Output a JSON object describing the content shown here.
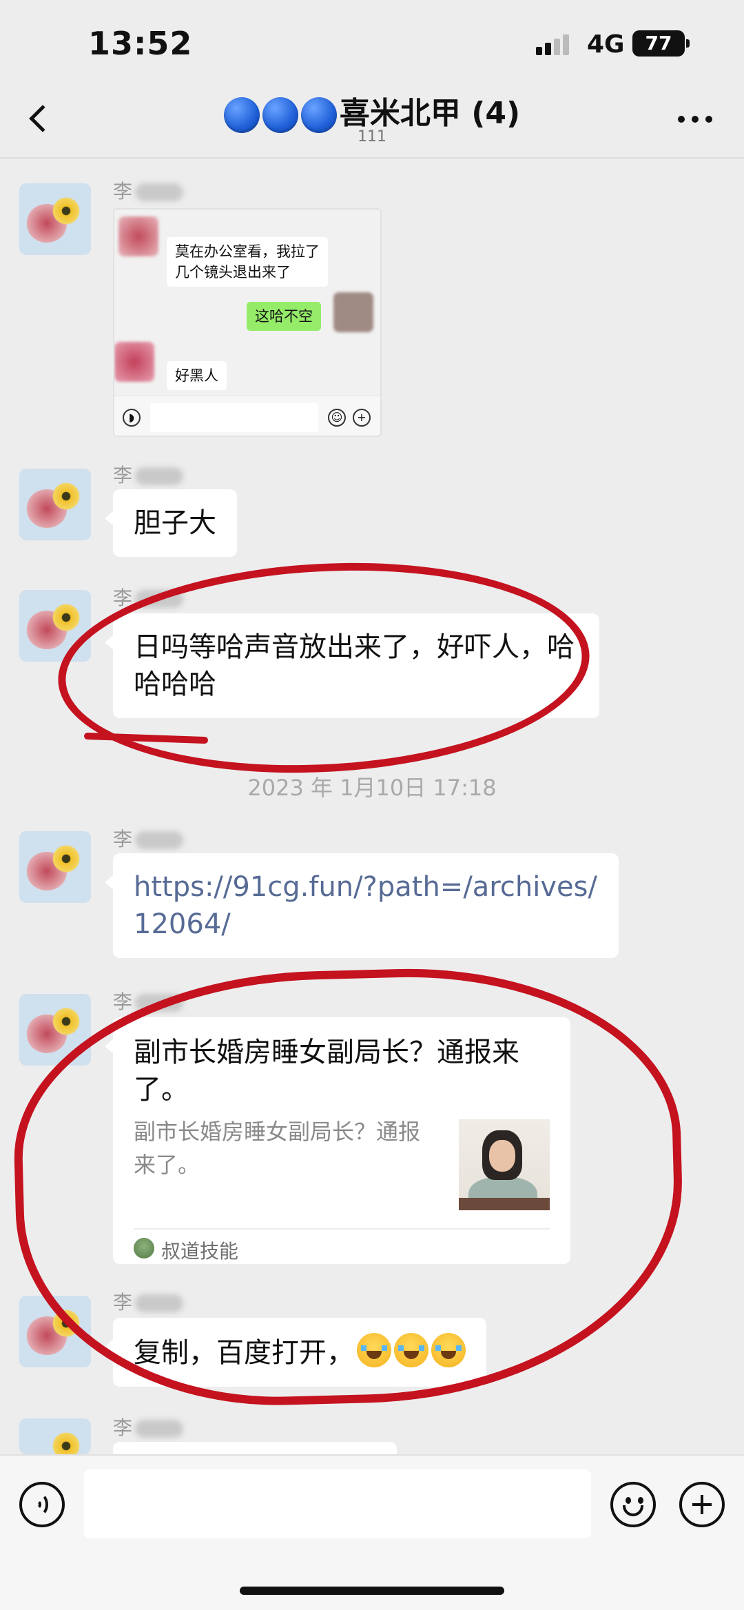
{
  "status_bar": {
    "time": "13:52",
    "network": "4G",
    "battery": "77"
  },
  "nav": {
    "title": "喜米北甲 (4)",
    "subtitle": "111",
    "title_icon": "blue-circle-emoji"
  },
  "messages": [
    {
      "sender": "李",
      "type": "image",
      "image_content": {
        "lines": [
          {
            "side": "left",
            "text": "莫在办公室看，我拉了\n几个镜头退出来了"
          },
          {
            "side": "right",
            "text": "这哈不空"
          },
          {
            "side": "left",
            "text": "好黑人"
          }
        ]
      }
    },
    {
      "sender": "李",
      "type": "text",
      "text": "胆子大"
    },
    {
      "sender": "李",
      "type": "text",
      "text": "日吗等哈声音放出来了，好吓人，哈哈哈哈"
    },
    {
      "sender": "李",
      "type": "link",
      "text": "https://91cg.fun/?path=/archives/12064/"
    },
    {
      "sender": "李",
      "type": "article",
      "title": "副市长婚房睡女副局长？通报来了。",
      "description": "副市长婚房睡女副局长？通报来了。",
      "source": "叔道技能"
    },
    {
      "sender": "李",
      "type": "text",
      "text": "复制，百度打开，",
      "emoji": [
        "face-with-tears-of-joy",
        "face-with-tears-of-joy",
        "face-with-tears-of-joy"
      ]
    }
  ],
  "timestamp": "2023 年 1月10日 17:18",
  "colors": {
    "annotation": "#c4121f",
    "link": "#576b95",
    "background": "#ededed",
    "sent_bubble": "#95ec69"
  }
}
